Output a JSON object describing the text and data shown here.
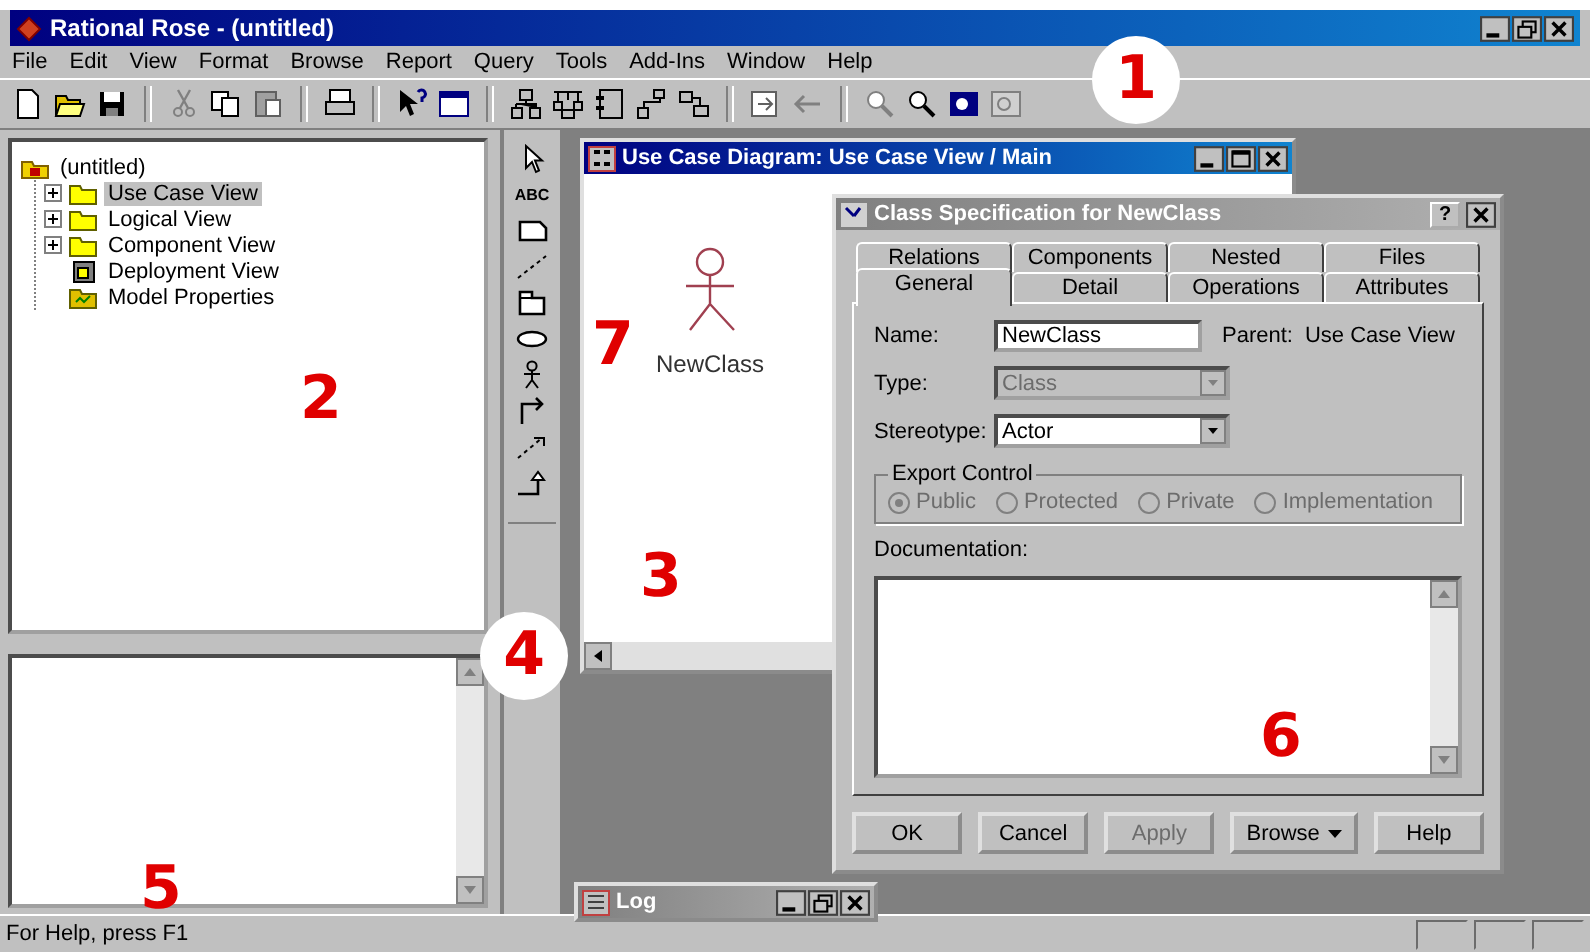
{
  "window": {
    "title": "Rational Rose - (untitled)"
  },
  "menu": [
    "File",
    "Edit",
    "View",
    "Format",
    "Browse",
    "Report",
    "Query",
    "Tools",
    "Add-Ins",
    "Window",
    "Help"
  ],
  "browser": {
    "label": "(untitled)",
    "selected": false,
    "children": [
      {
        "label": "Use Case View",
        "kind": "folder",
        "expandable": true,
        "selected": true
      },
      {
        "label": "Logical View",
        "kind": "folder",
        "expandable": true,
        "selected": false
      },
      {
        "label": "Component View",
        "kind": "folder",
        "expandable": true,
        "selected": false
      },
      {
        "label": "Deployment View",
        "kind": "deployment",
        "expandable": false,
        "selected": false
      },
      {
        "label": "Model Properties",
        "kind": "properties",
        "expandable": false,
        "selected": false
      }
    ]
  },
  "toolbox": {
    "text_tool": "ABC"
  },
  "diagram_window": {
    "title": "Use Case Diagram: Use Case View / Main",
    "actor_label": "NewClass"
  },
  "dialog": {
    "title": "Class Specification for NewClass",
    "help": "?",
    "tab_rows": [
      [
        {
          "label": "Relations",
          "selected": false
        },
        {
          "label": "Components",
          "selected": false
        },
        {
          "label": "Nested",
          "selected": false
        },
        {
          "label": "Files",
          "selected": false
        }
      ],
      [
        {
          "label": "General",
          "selected": true
        },
        {
          "label": "Detail",
          "selected": false
        },
        {
          "label": "Operations",
          "selected": false
        },
        {
          "label": "Attributes",
          "selected": false
        }
      ]
    ],
    "name": {
      "label": "Name:",
      "value": "NewClass"
    },
    "parent": {
      "label": "Parent:",
      "value": "Use Case View"
    },
    "type": {
      "label": "Type:",
      "value": "Class",
      "disabled": true
    },
    "stereotype": {
      "label": "Stereotype:",
      "value": "Actor",
      "disabled": false
    },
    "export_control": {
      "label": "Export Control",
      "options": [
        {
          "label": "Public",
          "checked": true,
          "disabled": true
        },
        {
          "label": "Protected",
          "checked": false,
          "disabled": true
        },
        {
          "label": "Private",
          "checked": false,
          "disabled": true
        },
        {
          "label": "Implementation",
          "checked": false,
          "disabled": true
        }
      ]
    },
    "documentation": {
      "label": "Documentation:"
    },
    "buttons": [
      {
        "label": "OK",
        "disabled": false,
        "dropdown": false
      },
      {
        "label": "Cancel",
        "disabled": false,
        "dropdown": false
      },
      {
        "label": "Apply",
        "disabled": true,
        "dropdown": false
      },
      {
        "label": "Browse",
        "disabled": false,
        "dropdown": true
      },
      {
        "label": "Help",
        "disabled": false,
        "dropdown": false
      }
    ]
  },
  "log_window": {
    "title": "Log"
  },
  "status_bar": {
    "text": "For Help, press F1"
  },
  "annotations": [
    {
      "text": "1",
      "circled": true
    },
    {
      "text": "2",
      "circled": false
    },
    {
      "text": "3",
      "circled": false
    },
    {
      "text": "4",
      "circled": true
    },
    {
      "text": "5",
      "circled": false
    },
    {
      "text": "6",
      "circled": false
    },
    {
      "text": "7",
      "circled": false
    }
  ]
}
